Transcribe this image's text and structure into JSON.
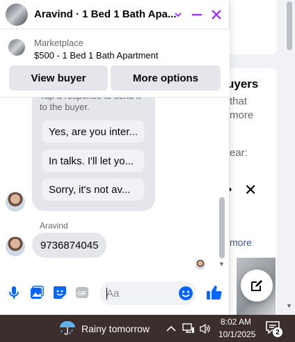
{
  "chat": {
    "title": "Aravind · 1 Bed 1 Bath Apa...",
    "listing": {
      "label": "Marketplace",
      "title": "$500 - 1 Bed 1 Bath Apartment",
      "view_buyer": "View buyer",
      "more_options": "More options"
    },
    "quick_replies": {
      "note": "Tap a response to send it to the buyer.",
      "items": [
        "Yes, are you inter...",
        "In talks. I'll let yo...",
        "Sorry, it's not av..."
      ]
    },
    "sender_name": "Aravind",
    "message": "9736874045",
    "composer": {
      "placeholder": "Aa"
    },
    "accent_color": "#0866ff",
    "header_icon_color": "#a033ff"
  },
  "background": {
    "heading": "uyers",
    "line1": "that",
    "line2": "more",
    "line3": "ear:",
    "link": "more"
  },
  "taskbar": {
    "weather": "Rainy tomorrow",
    "time": "8:02 AM",
    "date": "10/1/2025",
    "notification_count": "2"
  }
}
